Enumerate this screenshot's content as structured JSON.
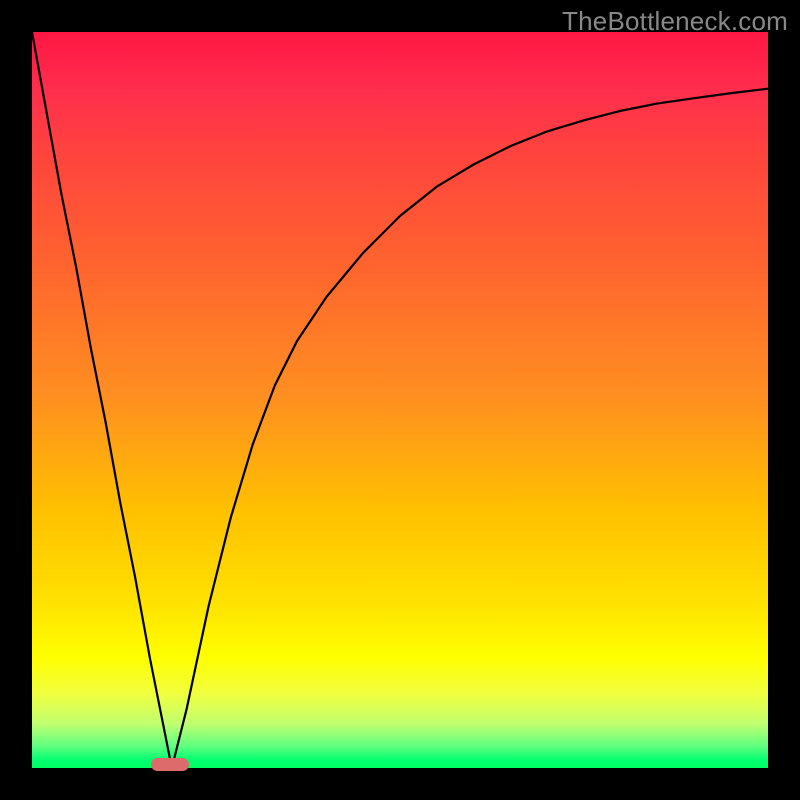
{
  "watermark": "TheBottleneck.com",
  "colors": {
    "gradient_top": "#ff1744",
    "gradient_bottom": "#00ff60",
    "frame": "#000000",
    "curve": "#000000",
    "marker": "#dd6b6b"
  },
  "chart_data": {
    "type": "line",
    "title": "",
    "xlabel": "",
    "ylabel": "",
    "xlim": [
      0,
      100
    ],
    "ylim": [
      0,
      100
    ],
    "grid": false,
    "series": [
      {
        "name": "curve",
        "x": [
          0,
          2,
          4,
          6,
          8,
          10,
          12,
          14,
          16,
          18,
          19,
          21,
          24,
          27,
          30,
          33,
          36,
          40,
          45,
          50,
          55,
          60,
          65,
          70,
          75,
          80,
          85,
          90,
          95,
          100
        ],
        "y": [
          100,
          89,
          78,
          68,
          57,
          47,
          36,
          26,
          15,
          5,
          0,
          8,
          22,
          34,
          44,
          52,
          58,
          64,
          70,
          75,
          79,
          82,
          84.5,
          86.5,
          88,
          89.3,
          90.3,
          91,
          91.7,
          92.3
        ]
      }
    ],
    "marker": {
      "x": 18.8,
      "y": 0.5,
      "width_pct": 5.2,
      "height_pct": 1.8
    }
  }
}
